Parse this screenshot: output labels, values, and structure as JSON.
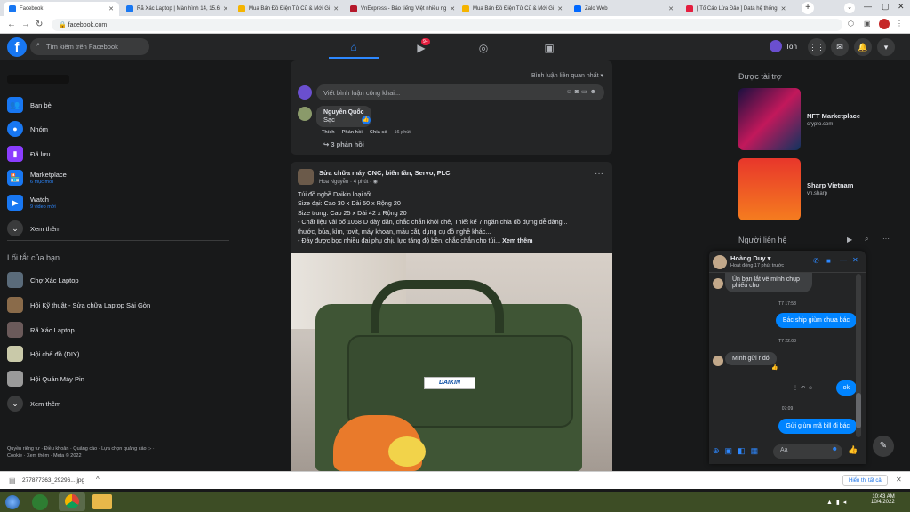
{
  "browser": {
    "tabs": [
      {
        "title": "Facebook",
        "color": "#1877f2",
        "active": true
      },
      {
        "title": "Rã Xác Laptop | Màn hình 14, 15.6",
        "color": "#1877f2"
      },
      {
        "title": "Mua Bán Đồ Điện Tử Cũ & Mới Gi",
        "color": "#f5b400"
      },
      {
        "title": "VnExpress - Báo tiếng Việt nhiều ng",
        "color": "#b5182b"
      },
      {
        "title": "Mua Bán Đồ Điện Tử Cũ & Mới Gi",
        "color": "#f5b400"
      },
      {
        "title": "Zalo Web",
        "color": "#0068ff"
      },
      {
        "title": "[ Tố Cáo Lừa Đảo ] Data hệ thống",
        "color": "#e41e3f"
      }
    ],
    "url": "facebook.com",
    "new_tab": "+"
  },
  "header": {
    "logo": "f",
    "search_placeholder": "Tìm kiếm trên Facebook",
    "video_badge": "9+",
    "profile_name": "Ton"
  },
  "left_sidebar": {
    "items": [
      {
        "label": "Bạn bè",
        "sub": "",
        "icon": "friends-icon",
        "color": "#1877f2"
      },
      {
        "label": "Nhóm",
        "sub": "",
        "icon": "groups-icon",
        "color": "#1877f2"
      },
      {
        "label": "Đã lưu",
        "sub": "",
        "icon": "bookmark-icon",
        "color": "#8b3dff"
      },
      {
        "label": "Marketplace",
        "sub": "6 mục mới",
        "icon": "marketplace-icon",
        "color": "#1877f2"
      },
      {
        "label": "Watch",
        "sub": "9 video mới",
        "icon": "watch-icon",
        "color": "#1877f2"
      },
      {
        "label": "Xem thêm",
        "sub": "",
        "icon": "chevron-down-icon",
        "color": "#3a3b3c"
      }
    ],
    "shortcuts_title": "Lối tắt của bạn",
    "shortcuts": [
      {
        "label": "Chợ Xác Laptop"
      },
      {
        "label": "Hội Kỹ thuật - Sửa chữa Laptop Sài Gòn"
      },
      {
        "label": "Rã Xác Laptop"
      },
      {
        "label": "Hội chế đồ (DIY)"
      },
      {
        "label": "Hội Quán Máy Pin"
      },
      {
        "label": "Xem thêm"
      }
    ],
    "footer": "Quyền riêng tư · Điều khoản · Quảng cáo · Lựa chọn quảng cáo ▷ · Cookie · Xem thêm · Meta © 2022"
  },
  "comment_section": {
    "sort_label": "Bình luận liên quan nhất",
    "comment_placeholder": "Viết bình luận công khai...",
    "comment_author": "Nguyễn Quốc",
    "comment_text": "Sạc",
    "actions": [
      "Thích",
      "Phản hồi",
      "Chia sẻ"
    ],
    "comment_time": "16 phút",
    "replies": "3 phản hồi"
  },
  "post": {
    "group": "Sửa chữa máy CNC, biến tần, Servo, PLC",
    "author": "Hoa Nguyễn",
    "time": "4 phút",
    "lines": [
      "Túi đồ nghề Daikin loại tốt",
      "Size đại: Cao 30 x Dài 50 x Rộng 20",
      "Size trung: Cao 25 x Dài 42 x Rộng 20",
      "- Chất liệu vải bố 1068 D dày dặn, chắc chắn khỏi chê, Thiết kế 7 ngăn chia đồ đựng dễ dàng...",
      "thước, búa, kìm, tovit, máy khoan, máu cắt, dụng cụ đồ nghề khác...",
      "- Đáy được bọc nhiều đai phụ chịu lực tăng độ bền, chắc chắn cho túi..."
    ],
    "see_more": "Xem thêm",
    "bag_logo": "DAIKIN"
  },
  "right_sidebar": {
    "sponsored_title": "Được tài trợ",
    "ads": [
      {
        "title": "NFT Marketplace",
        "domain": "crypto.com"
      },
      {
        "title": "Sharp Vietnam",
        "domain": "vn.sharp"
      }
    ],
    "contacts_title": "Người liên hệ"
  },
  "chat": {
    "name": "Hoàng Duy",
    "status": "Hoạt động 17 phút trước",
    "messages": [
      {
        "from": "them",
        "text": "Ún bạn lắt về mình chụp phiếu cho"
      },
      {
        "time": "T7 17:58"
      },
      {
        "from": "me",
        "text": "Bác ship giùm chưa bác"
      },
      {
        "time": "T7 22:03"
      },
      {
        "from": "them",
        "text": "Mình gửi r đó"
      },
      {
        "from": "me",
        "text": "ok"
      },
      {
        "time": "07:09"
      },
      {
        "from": "me",
        "text": "Gửi giùm mã bill đi bác"
      }
    ],
    "input_placeholder": "Aa"
  },
  "downloads": {
    "file": "277877363_29296....jpg",
    "show_all": "Hiển thị tất cả"
  },
  "taskbar": {
    "time": "10:43 AM",
    "date": "10/4/2022"
  }
}
